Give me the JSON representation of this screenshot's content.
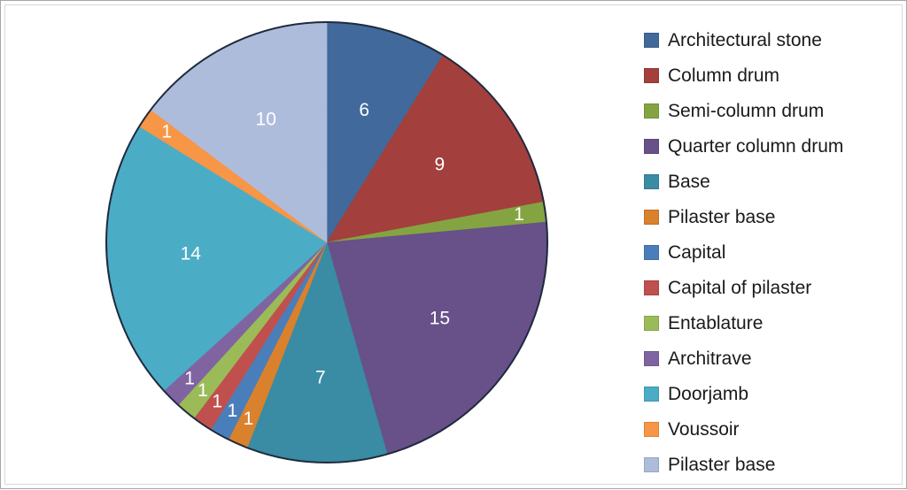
{
  "chart_data": {
    "type": "pie",
    "title": "",
    "legend_position": "right",
    "start_angle_deg": 0,
    "direction": "clockwise",
    "total": 68,
    "categories": [
      "Architectural stone",
      "Column drum",
      "Semi-column drum",
      "Quarter column drum",
      "Base",
      "Pilaster base",
      "Capital",
      "Capital of pilaster",
      "Entablature",
      "Architrave",
      "Doorjamb",
      "Voussoir",
      "Pilaster base"
    ],
    "values": [
      6,
      9,
      1,
      15,
      7,
      1,
      1,
      1,
      1,
      1,
      14,
      1,
      10
    ],
    "colors": [
      "#41699B",
      "#A33F3C",
      "#84A442",
      "#685089",
      "#3A8BA4",
      "#D9812C",
      "#4A7EBB",
      "#C0504D",
      "#9BBB59",
      "#8064A2",
      "#4BACC6",
      "#F79646",
      "#AEBCDC"
    ],
    "data_labels": [
      "6",
      "9",
      "1",
      "15",
      "7",
      "1",
      "1",
      "1",
      "1",
      "1",
      "14",
      "1",
      "10"
    ],
    "data_label_color": "#ffffff",
    "slice_border_color": "#1f2a3d",
    "xlabel": "",
    "ylabel": ""
  },
  "legend": {
    "items": [
      {
        "label": "Architectural stone",
        "color": "#41699B"
      },
      {
        "label": "Column drum",
        "color": "#A33F3C"
      },
      {
        "label": "Semi-column drum",
        "color": "#84A442"
      },
      {
        "label": "Quarter column drum",
        "color": "#685089"
      },
      {
        "label": "Base",
        "color": "#3A8BA4"
      },
      {
        "label": "Pilaster base",
        "color": "#D9812C"
      },
      {
        "label": "Capital",
        "color": "#4A7EBB"
      },
      {
        "label": "Capital of pilaster",
        "color": "#C0504D"
      },
      {
        "label": "Entablature",
        "color": "#9BBB59"
      },
      {
        "label": "Architrave",
        "color": "#8064A2"
      },
      {
        "label": "Doorjamb",
        "color": "#4BACC6"
      },
      {
        "label": "Voussoir",
        "color": "#F79646"
      },
      {
        "label": "Pilaster base",
        "color": "#AEBCDC"
      }
    ]
  },
  "frame": {
    "outer_border_color": "#a6a6a6",
    "inner_border_color": "#d9d9d9",
    "background": "#ffffff"
  }
}
